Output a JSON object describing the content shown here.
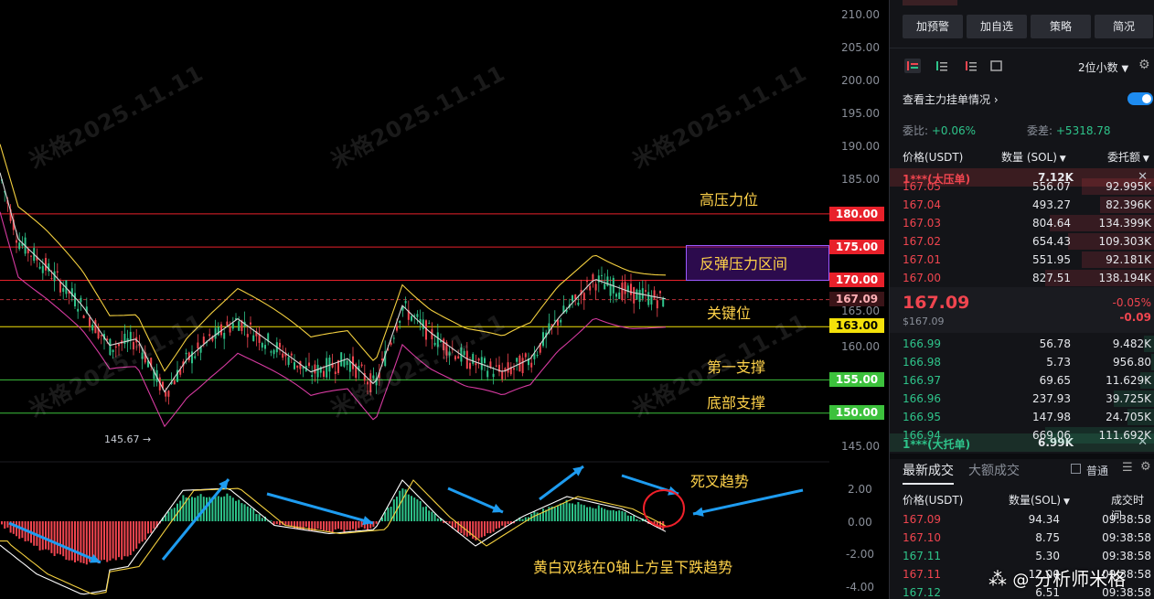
{
  "chart": {
    "price_axis": [
      "210.00",
      "205.00",
      "200.00",
      "195.00",
      "190.00",
      "185.00",
      "165.00",
      "160.00",
      "145.00"
    ],
    "macd_axis": [
      "2.00",
      "0.00",
      "-2.00",
      "-4.00"
    ],
    "levels": [
      {
        "label": "180.00",
        "color": "#e8202a"
      },
      {
        "label": "175.00",
        "color": "#e8202a"
      },
      {
        "label": "170.00",
        "color": "#e8202a"
      },
      {
        "label": "167.09",
        "color": "#b8303a"
      },
      {
        "label": "163.00",
        "color": "#f4e10a"
      },
      {
        "label": "155.00",
        "color": "#3cc13c"
      },
      {
        "label": "150.00",
        "color": "#3cc13c"
      }
    ],
    "annotations": {
      "high_pressure": "高压力位",
      "rebound_zone": "反弹压力区间",
      "key_level": "关键位",
      "first_support": "第一支撑",
      "bottom_support": "底部支撑",
      "death_cross": "死叉趋势",
      "macd_note": "黄白双线在0轴上方呈下跌趋势"
    },
    "low_marker": "145.67 →",
    "watermark": "米格2025.11.11",
    "author_tag": "分析师米格"
  },
  "panel": {
    "top_buttons": [
      "加预警",
      "加自选",
      "策略",
      "简况"
    ],
    "decimal_select": "2位小数",
    "main_order_label": "查看主力挂单情况",
    "ratio": {
      "label": "委比:",
      "value": "+0.06%",
      "diff_label": "委差:",
      "diff_value": "+5318.78"
    },
    "headers": {
      "price": "价格(USDT)",
      "qty": "数量 (SOL)",
      "amount": "委托额"
    },
    "ask_banner": {
      "label": "1***(大压单)",
      "value": "7.12K"
    },
    "asks": [
      {
        "price": "167.05",
        "qty": "556.07",
        "amt": "92.995K"
      },
      {
        "price": "167.04",
        "qty": "493.27",
        "amt": "82.396K"
      },
      {
        "price": "167.03",
        "qty": "804.64",
        "amt": "134.399K"
      },
      {
        "price": "167.02",
        "qty": "654.43",
        "amt": "109.303K"
      },
      {
        "price": "167.01",
        "qty": "551.95",
        "amt": "92.181K"
      },
      {
        "price": "167.00",
        "qty": "827.51",
        "amt": "138.194K"
      }
    ],
    "last": {
      "price": "167.09",
      "sub": "$167.09",
      "pct": "-0.05%",
      "chg": "-0.09"
    },
    "bids": [
      {
        "price": "166.99",
        "qty": "56.78",
        "amt": "9.482K"
      },
      {
        "price": "166.98",
        "qty": "5.73",
        "amt": "956.80"
      },
      {
        "price": "166.97",
        "qty": "69.65",
        "amt": "11.629K"
      },
      {
        "price": "166.96",
        "qty": "237.93",
        "amt": "39.725K"
      },
      {
        "price": "166.95",
        "qty": "147.98",
        "amt": "24.705K"
      },
      {
        "price": "166.94",
        "qty": "669.06",
        "amt": "111.692K"
      }
    ],
    "bid_banner": {
      "label": "1***(大托单)",
      "value": "6.99K"
    },
    "trades_tabs": [
      "最新成交",
      "大额成交"
    ],
    "trades_mode": "普通",
    "trades_headers": {
      "price": "价格(USDT)",
      "qty": "数量(SOL)",
      "time": "成交时间"
    },
    "trades": [
      {
        "price": "167.09",
        "qty": "94.34",
        "time": "09:38:58",
        "side": "red"
      },
      {
        "price": "167.10",
        "qty": "8.75",
        "time": "09:38:58",
        "side": "red"
      },
      {
        "price": "167.11",
        "qty": "5.30",
        "time": "09:38:58",
        "side": "green"
      },
      {
        "price": "167.11",
        "qty": "12.00",
        "time": "09:38:58",
        "side": "red"
      },
      {
        "price": "167.12",
        "qty": "6.51",
        "time": "09:38:58",
        "side": "green"
      }
    ]
  }
}
